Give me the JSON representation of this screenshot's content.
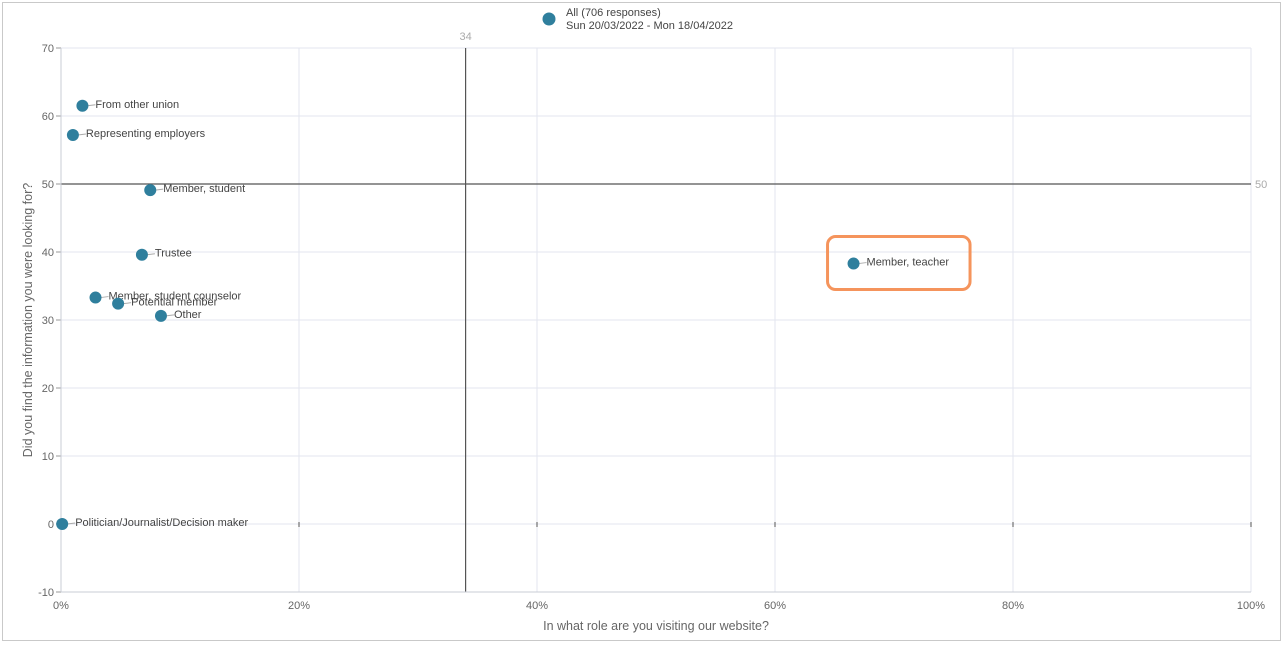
{
  "chart_data": {
    "type": "scatter",
    "title": "",
    "xlabel": "In what role are you visiting our website?",
    "ylabel": "Did you find the information you were looking for?",
    "xlim": [
      0,
      100
    ],
    "ylim": [
      -10,
      70
    ],
    "x_ticks": [
      "0%",
      "20%",
      "40%",
      "60%",
      "80%",
      "100%"
    ],
    "y_ticks": [
      "-10",
      "0",
      "10",
      "20",
      "30",
      "40",
      "50",
      "60",
      "70"
    ],
    "grid": true,
    "reference_lines": {
      "x": 34,
      "x_label": "34",
      "y": 50,
      "y_label": "50"
    },
    "legend": {
      "label": "All (706 responses)",
      "date_range": "Sun 20/03/2022 - Mon 18/04/2022",
      "color": "#2f7f9d",
      "position": "top-center"
    },
    "point_color": "#2f7f9d",
    "highlight_color": "#f5945c",
    "points": [
      {
        "label": "From other union",
        "x": 1.8,
        "y": 61.5
      },
      {
        "label": "Representing employers",
        "x": 1.0,
        "y": 57.2
      },
      {
        "label": "Member, student",
        "x": 7.5,
        "y": 49.1
      },
      {
        "label": "Trustee",
        "x": 6.8,
        "y": 39.6
      },
      {
        "label": "Member, teacher",
        "x": 66.6,
        "y": 38.3,
        "highlighted": true
      },
      {
        "label": "Member, student counselor",
        "x": 2.9,
        "y": 33.3
      },
      {
        "label": "Potential member",
        "x": 4.8,
        "y": 32.4
      },
      {
        "label": "Other",
        "x": 8.4,
        "y": 30.6
      },
      {
        "label": "Politician/Journalist/Decision maker",
        "x": 0.1,
        "y": 0.0
      }
    ]
  }
}
